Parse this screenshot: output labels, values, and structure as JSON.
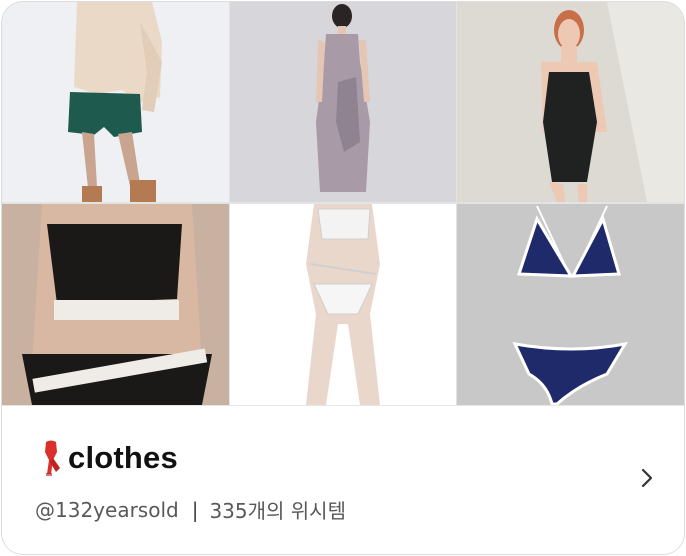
{
  "board": {
    "title": "clothes",
    "title_emoji": "scarf-icon",
    "username": "@132yearsold",
    "separator": "|",
    "count_text": "335개의 위시템",
    "open_icon": "chevron-right-icon"
  },
  "tiles": [
    {
      "name": "tile-knit-sweater-shorts",
      "icon": "product-photo"
    },
    {
      "name": "tile-lilac-slip-dress",
      "icon": "product-photo"
    },
    {
      "name": "tile-black-swimsuit",
      "icon": "product-photo"
    },
    {
      "name": "tile-sports-bra-set",
      "icon": "product-photo"
    },
    {
      "name": "tile-white-strappy-bikini",
      "icon": "product-photo"
    },
    {
      "name": "tile-navy-triangle-bikini",
      "icon": "product-photo"
    }
  ],
  "colors": {
    "title": "#111111",
    "meta": "#595959",
    "navy": "#1f2a6b",
    "swatch_gray": "#c8c8c8"
  }
}
